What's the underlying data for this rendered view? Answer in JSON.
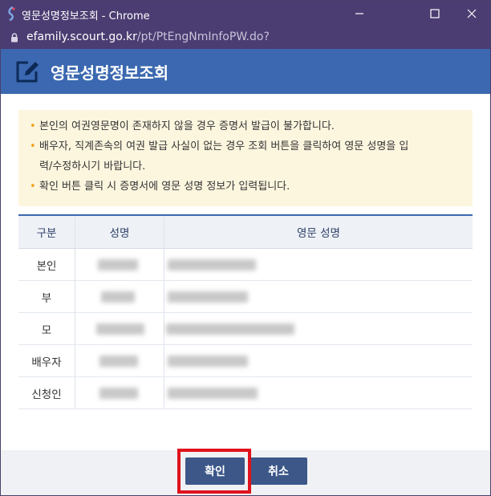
{
  "window": {
    "title": "영문성명정보조회 - Chrome"
  },
  "address_bar": {
    "domain": "efamily.scourt.go.kr",
    "path": "/pt/PtEngNmInfoPW.do?"
  },
  "header": {
    "title": "영문성명정보조회"
  },
  "notices": [
    "본인의 여권영문명이 존재하지 않을 경우 증명서 발급이 불가합니다.",
    "배우자, 직계존속의 여권 발급 사실이 없는 경우 조회 버튼을 클릭하여 영문 성명을 입",
    "력/수정하시기 바랍니다.",
    "확인 버튼 클릭 시 증명서에 영문 성명 정보가 입력됩니다."
  ],
  "table": {
    "headers": [
      "구분",
      "성명",
      "영문 성명"
    ],
    "rows": [
      {
        "type": "본인"
      },
      {
        "type": "부"
      },
      {
        "type": "모"
      },
      {
        "type": "배우자"
      },
      {
        "type": "신청인"
      }
    ]
  },
  "buttons": {
    "confirm": "확인",
    "cancel": "취소"
  },
  "colors": {
    "titlebar": "#4b3d72",
    "header": "#3b68b0",
    "button": "#3c5788",
    "highlight": "#e0121c",
    "notice_bg": "#fdf6df"
  }
}
